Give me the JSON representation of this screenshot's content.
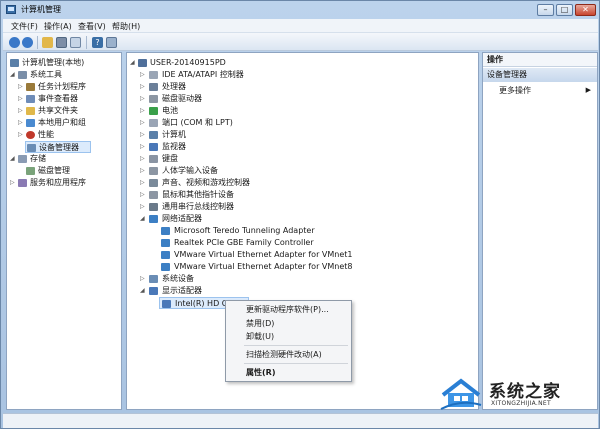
{
  "window": {
    "title": "计算机管理"
  },
  "titlebar": {
    "min": "–",
    "max": "□",
    "close": "✕"
  },
  "menu": [
    "文件(F)",
    "操作(A)",
    "查看(V)",
    "帮助(H)"
  ],
  "left_tree": [
    {
      "label": "计算机管理(本地)",
      "toggle": "",
      "icon_color": "#5a7fa8"
    },
    {
      "label": "系统工具",
      "toggle": "◢",
      "icon_color": "#7a8ea8"
    },
    {
      "label": "任务计划程序",
      "toggle": "▷",
      "icon_color": "#9a7a3a"
    },
    {
      "label": "事件查看器",
      "toggle": "▷",
      "icon_color": "#6e8cb8"
    },
    {
      "label": "共享文件夹",
      "toggle": "▷",
      "icon_color": "#e0b84a"
    },
    {
      "label": "本地用户和组",
      "toggle": "▷",
      "icon_color": "#4a8ad0"
    },
    {
      "label": "性能",
      "toggle": "▷",
      "icon_color": "#c0392b"
    },
    {
      "label": "设备管理器",
      "toggle": "",
      "icon_color": "#6a8db5"
    },
    {
      "label": "存储",
      "toggle": "◢",
      "icon_color": "#8a9bb3"
    },
    {
      "label": "磁盘管理",
      "toggle": "",
      "icon_color": "#7aa37a"
    },
    {
      "label": "服务和应用程序",
      "toggle": "▷",
      "icon_color": "#8a7ab3"
    }
  ],
  "device_tree": [
    {
      "label": "USER-20140915PD",
      "toggle": "◢",
      "icon_color": "#4f6f9a"
    },
    {
      "label": "IDE ATA/ATAPI 控制器",
      "toggle": "▷",
      "icon_color": "#9aa5b5"
    },
    {
      "label": "处理器",
      "toggle": "▷",
      "icon_color": "#6b7f99"
    },
    {
      "label": "磁盘驱动器",
      "toggle": "▷",
      "icon_color": "#8c96a3"
    },
    {
      "label": "电池",
      "toggle": "▷",
      "icon_color": "#3aa04a"
    },
    {
      "label": "端口 (COM 和 LPT)",
      "toggle": "▷",
      "icon_color": "#9aa5b5"
    },
    {
      "label": "计算机",
      "toggle": "▷",
      "icon_color": "#5a7fa8"
    },
    {
      "label": "监视器",
      "toggle": "▷",
      "icon_color": "#4a78b8"
    },
    {
      "label": "键盘",
      "toggle": "▷",
      "icon_color": "#8a94a3"
    },
    {
      "label": "人体学输入设备",
      "toggle": "▷",
      "icon_color": "#8c96a3"
    },
    {
      "label": "声音、视频和游戏控制器",
      "toggle": "▷",
      "icon_color": "#7a8a9a"
    },
    {
      "label": "鼠标和其他指针设备",
      "toggle": "▷",
      "icon_color": "#8c96a3"
    },
    {
      "label": "通用串行总线控制器",
      "toggle": "▷",
      "icon_color": "#6a7a8a"
    },
    {
      "label": "网络适配器",
      "toggle": "◢",
      "icon_color": "#3c7fc4"
    },
    {
      "label": "Microsoft Teredo Tunneling Adapter",
      "toggle": "",
      "icon_color": "#3c7fc4"
    },
    {
      "label": "Realtek PCIe GBE Family Controller",
      "toggle": "",
      "icon_color": "#3c7fc4"
    },
    {
      "label": "VMware Virtual Ethernet Adapter for VMnet1",
      "toggle": "",
      "icon_color": "#3c7fc4"
    },
    {
      "label": "VMware Virtual Ethernet Adapter for VMnet8",
      "toggle": "",
      "icon_color": "#3c7fc4"
    },
    {
      "label": "系统设备",
      "toggle": "▷",
      "icon_color": "#6a8db5"
    },
    {
      "label": "显示适配器",
      "toggle": "◢",
      "icon_color": "#4a78b8"
    },
    {
      "label": "Intel(R) HD Graphi",
      "toggle": "",
      "icon_color": "#4a78b8"
    }
  ],
  "actions": {
    "header": "操作",
    "section": "设备管理器",
    "more": "更多操作",
    "more_arrow": "▶"
  },
  "context_menu": {
    "items": [
      "更新驱动程序软件(P)...",
      "禁用(D)",
      "卸载(U)",
      "扫描检测硬件改动(A)",
      "属性(R)"
    ]
  },
  "watermark": {
    "title": "系统之家",
    "url": "XITONGZHIJIA.NET"
  },
  "colors": {
    "accent": "#3c7fc4",
    "selection": "#dcebfc"
  }
}
